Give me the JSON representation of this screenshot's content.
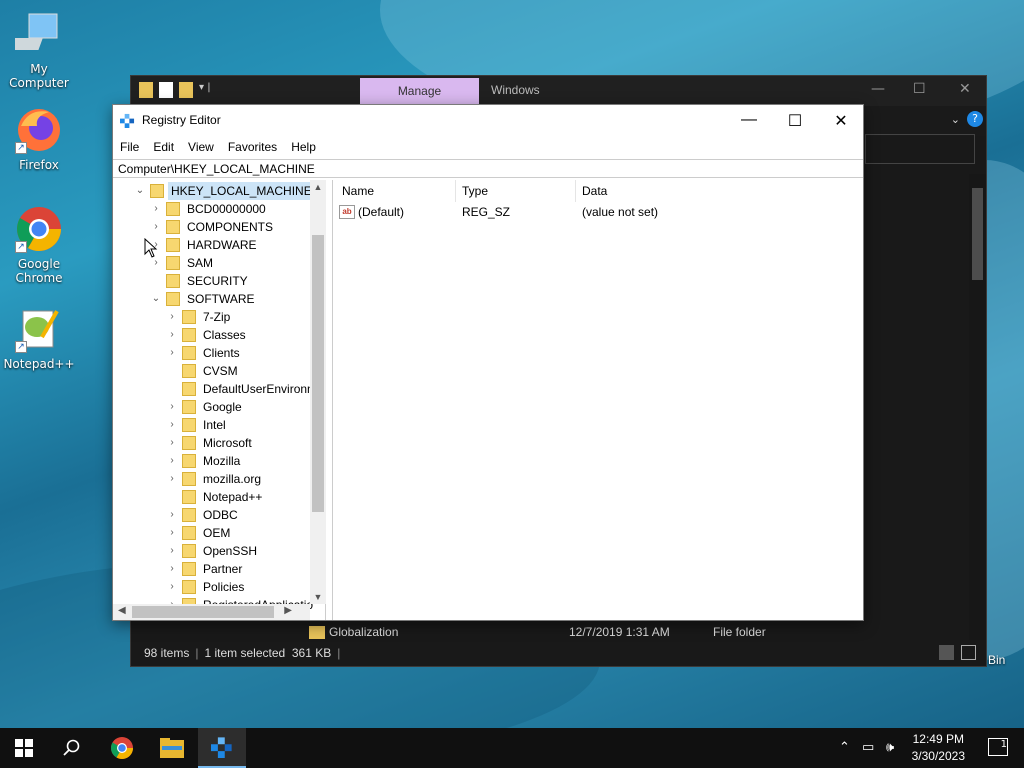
{
  "desktop": {
    "icons": [
      {
        "label": "My Computer",
        "icon": "computer-icon"
      },
      {
        "label": "Firefox",
        "icon": "firefox-icon"
      },
      {
        "label": "Google Chrome",
        "icon": "chrome-icon"
      },
      {
        "label": "Notepad++",
        "icon": "notepadpp-icon"
      }
    ],
    "recycle_bin_partial": "Bin"
  },
  "explorer": {
    "tab_manage": "Manage",
    "tab_windows": "Windows",
    "visible_row": {
      "name": "Globalization",
      "date": "12/7/2019 1:31 AM",
      "type": "File folder"
    },
    "status": {
      "items": "98 items",
      "selected": "1 item selected",
      "size": "361 KB"
    }
  },
  "regedit": {
    "title": "Registry Editor",
    "menu": [
      "File",
      "Edit",
      "View",
      "Favorites",
      "Help"
    ],
    "address": "Computer\\HKEY_LOCAL_MACHINE",
    "tree": {
      "root": "HKEY_LOCAL_MACHINE",
      "level1": [
        "BCD00000000",
        "COMPONENTS",
        "HARDWARE",
        "SAM",
        "SECURITY",
        "SOFTWARE"
      ],
      "software_children": [
        "7-Zip",
        "Classes",
        "Clients",
        "CVSM",
        "DefaultUserEnvironn",
        "Google",
        "Intel",
        "Microsoft",
        "Mozilla",
        "mozilla.org",
        "Notepad++",
        "ODBC",
        "OEM",
        "OpenSSH",
        "Partner",
        "Policies",
        "RegisteredApplicatio"
      ]
    },
    "columns": {
      "name": "Name",
      "type": "Type",
      "data": "Data"
    },
    "values": [
      {
        "name": "(Default)",
        "type": "REG_SZ",
        "data": "(value not set)"
      }
    ]
  },
  "taskbar": {
    "time": "12:49 PM",
    "date": "3/30/2023",
    "notification_count": "1"
  },
  "colors": {
    "manage_tab": "#d9b8ef",
    "selection": "#cce4f7",
    "folder": "#f7d770"
  }
}
